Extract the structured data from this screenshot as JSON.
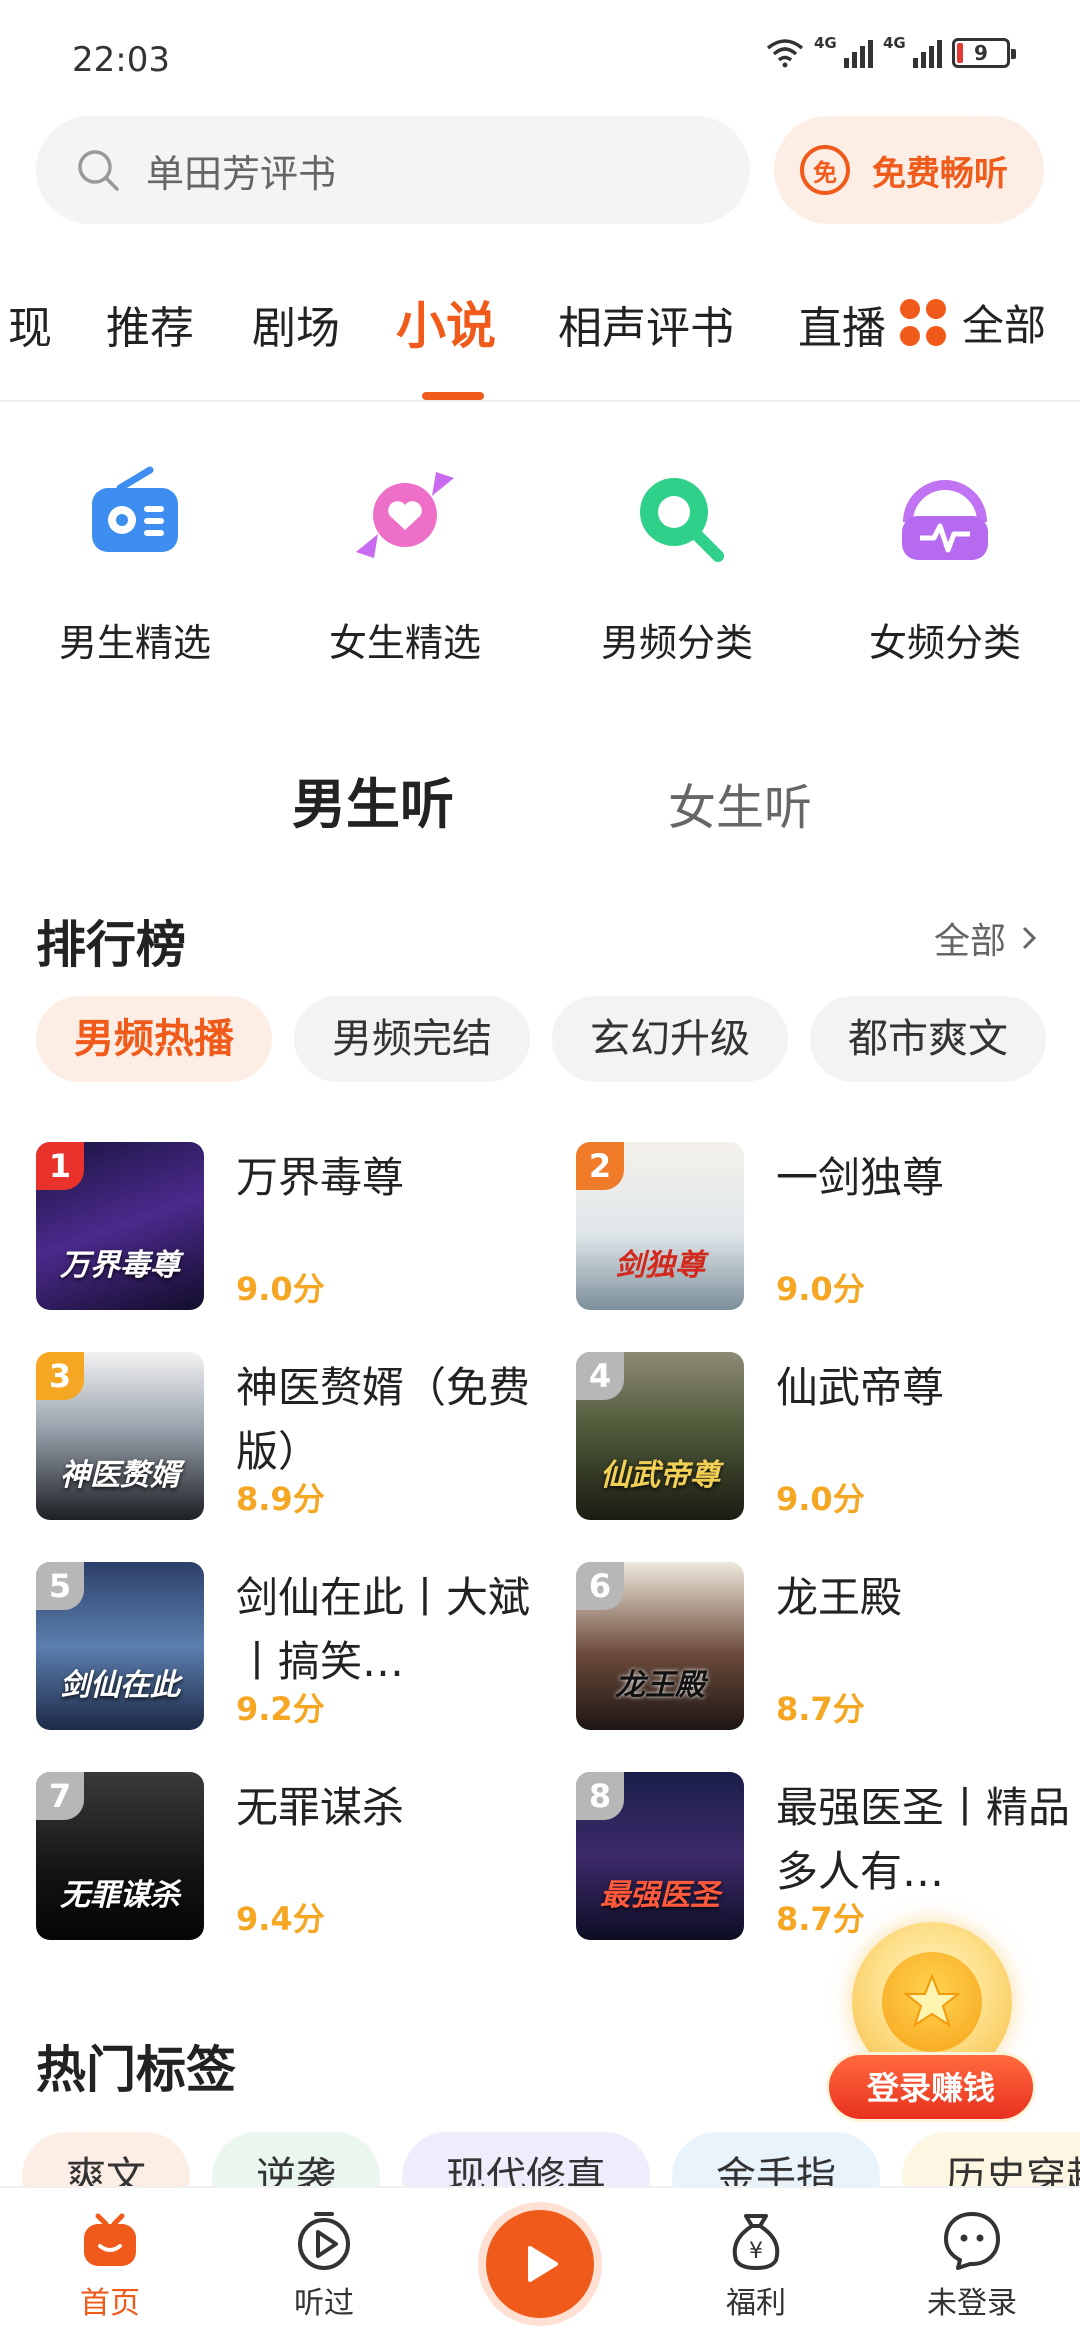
{
  "status_bar": {
    "time": "22:03",
    "battery": "9",
    "network": [
      "4G",
      "4G"
    ]
  },
  "search": {
    "placeholder": "单田芳评书",
    "free_label": "免费畅听",
    "free_icon_text": "免"
  },
  "tabs": [
    {
      "label": "现"
    },
    {
      "label": "推荐"
    },
    {
      "label": "剧场"
    },
    {
      "label": "小说",
      "active": true
    },
    {
      "label": "相声评书"
    },
    {
      "label": "直播"
    }
  ],
  "all_label": "全部",
  "categories": [
    {
      "label": "男生精选",
      "icon": "radio-icon"
    },
    {
      "label": "女生精选",
      "icon": "candy-heart-icon"
    },
    {
      "label": "男频分类",
      "icon": "magnifier-icon"
    },
    {
      "label": "女频分类",
      "icon": "headphones-icon"
    }
  ],
  "gender": {
    "male": "男生听",
    "female": "女生听"
  },
  "ranking": {
    "title": "排行榜",
    "all_label": "全部",
    "chips": [
      {
        "label": "男频热播",
        "active": true
      },
      {
        "label": "男频完结"
      },
      {
        "label": "玄幻升级"
      },
      {
        "label": "都市爽文"
      }
    ],
    "books": [
      {
        "rank": "1",
        "name": "万界毒尊",
        "score": "9.0分",
        "cover_text": "万界毒尊"
      },
      {
        "rank": "2",
        "name": "一剑独尊",
        "score": "9.0分",
        "cover_text": "剑独尊"
      },
      {
        "rank": "3",
        "name": "神医赘婿（免费版）",
        "score": "8.9分",
        "cover_text": "神医赘婿"
      },
      {
        "rank": "4",
        "name": "仙武帝尊",
        "score": "9.0分",
        "cover_text": "仙武帝尊"
      },
      {
        "rank": "5",
        "name": "剑仙在此丨大斌丨搞笑…",
        "score": "9.2分",
        "cover_text": "剑仙在此"
      },
      {
        "rank": "6",
        "name": "龙王殿",
        "score": "8.7分",
        "cover_text": "龙王殿"
      },
      {
        "rank": "7",
        "name": "无罪谋杀",
        "score": "9.4分",
        "cover_text": "无罪谋杀"
      },
      {
        "rank": "8",
        "name": "最强医圣丨精品多人有…",
        "score": "8.7分",
        "cover_text": "最强医圣"
      }
    ]
  },
  "hot_tags": {
    "title": "热门标签",
    "tags": [
      "爽文",
      "逆袭",
      "现代修真",
      "金手指",
      "历史穿越"
    ]
  },
  "float": {
    "login_earn": "登录赚钱"
  },
  "bottom_nav": [
    {
      "label": "首页",
      "active": true
    },
    {
      "label": "听过"
    },
    {
      "label": "福利"
    },
    {
      "label": "未登录"
    }
  ],
  "colors": {
    "accent": "#f05a1a",
    "score": "#f5a623"
  }
}
